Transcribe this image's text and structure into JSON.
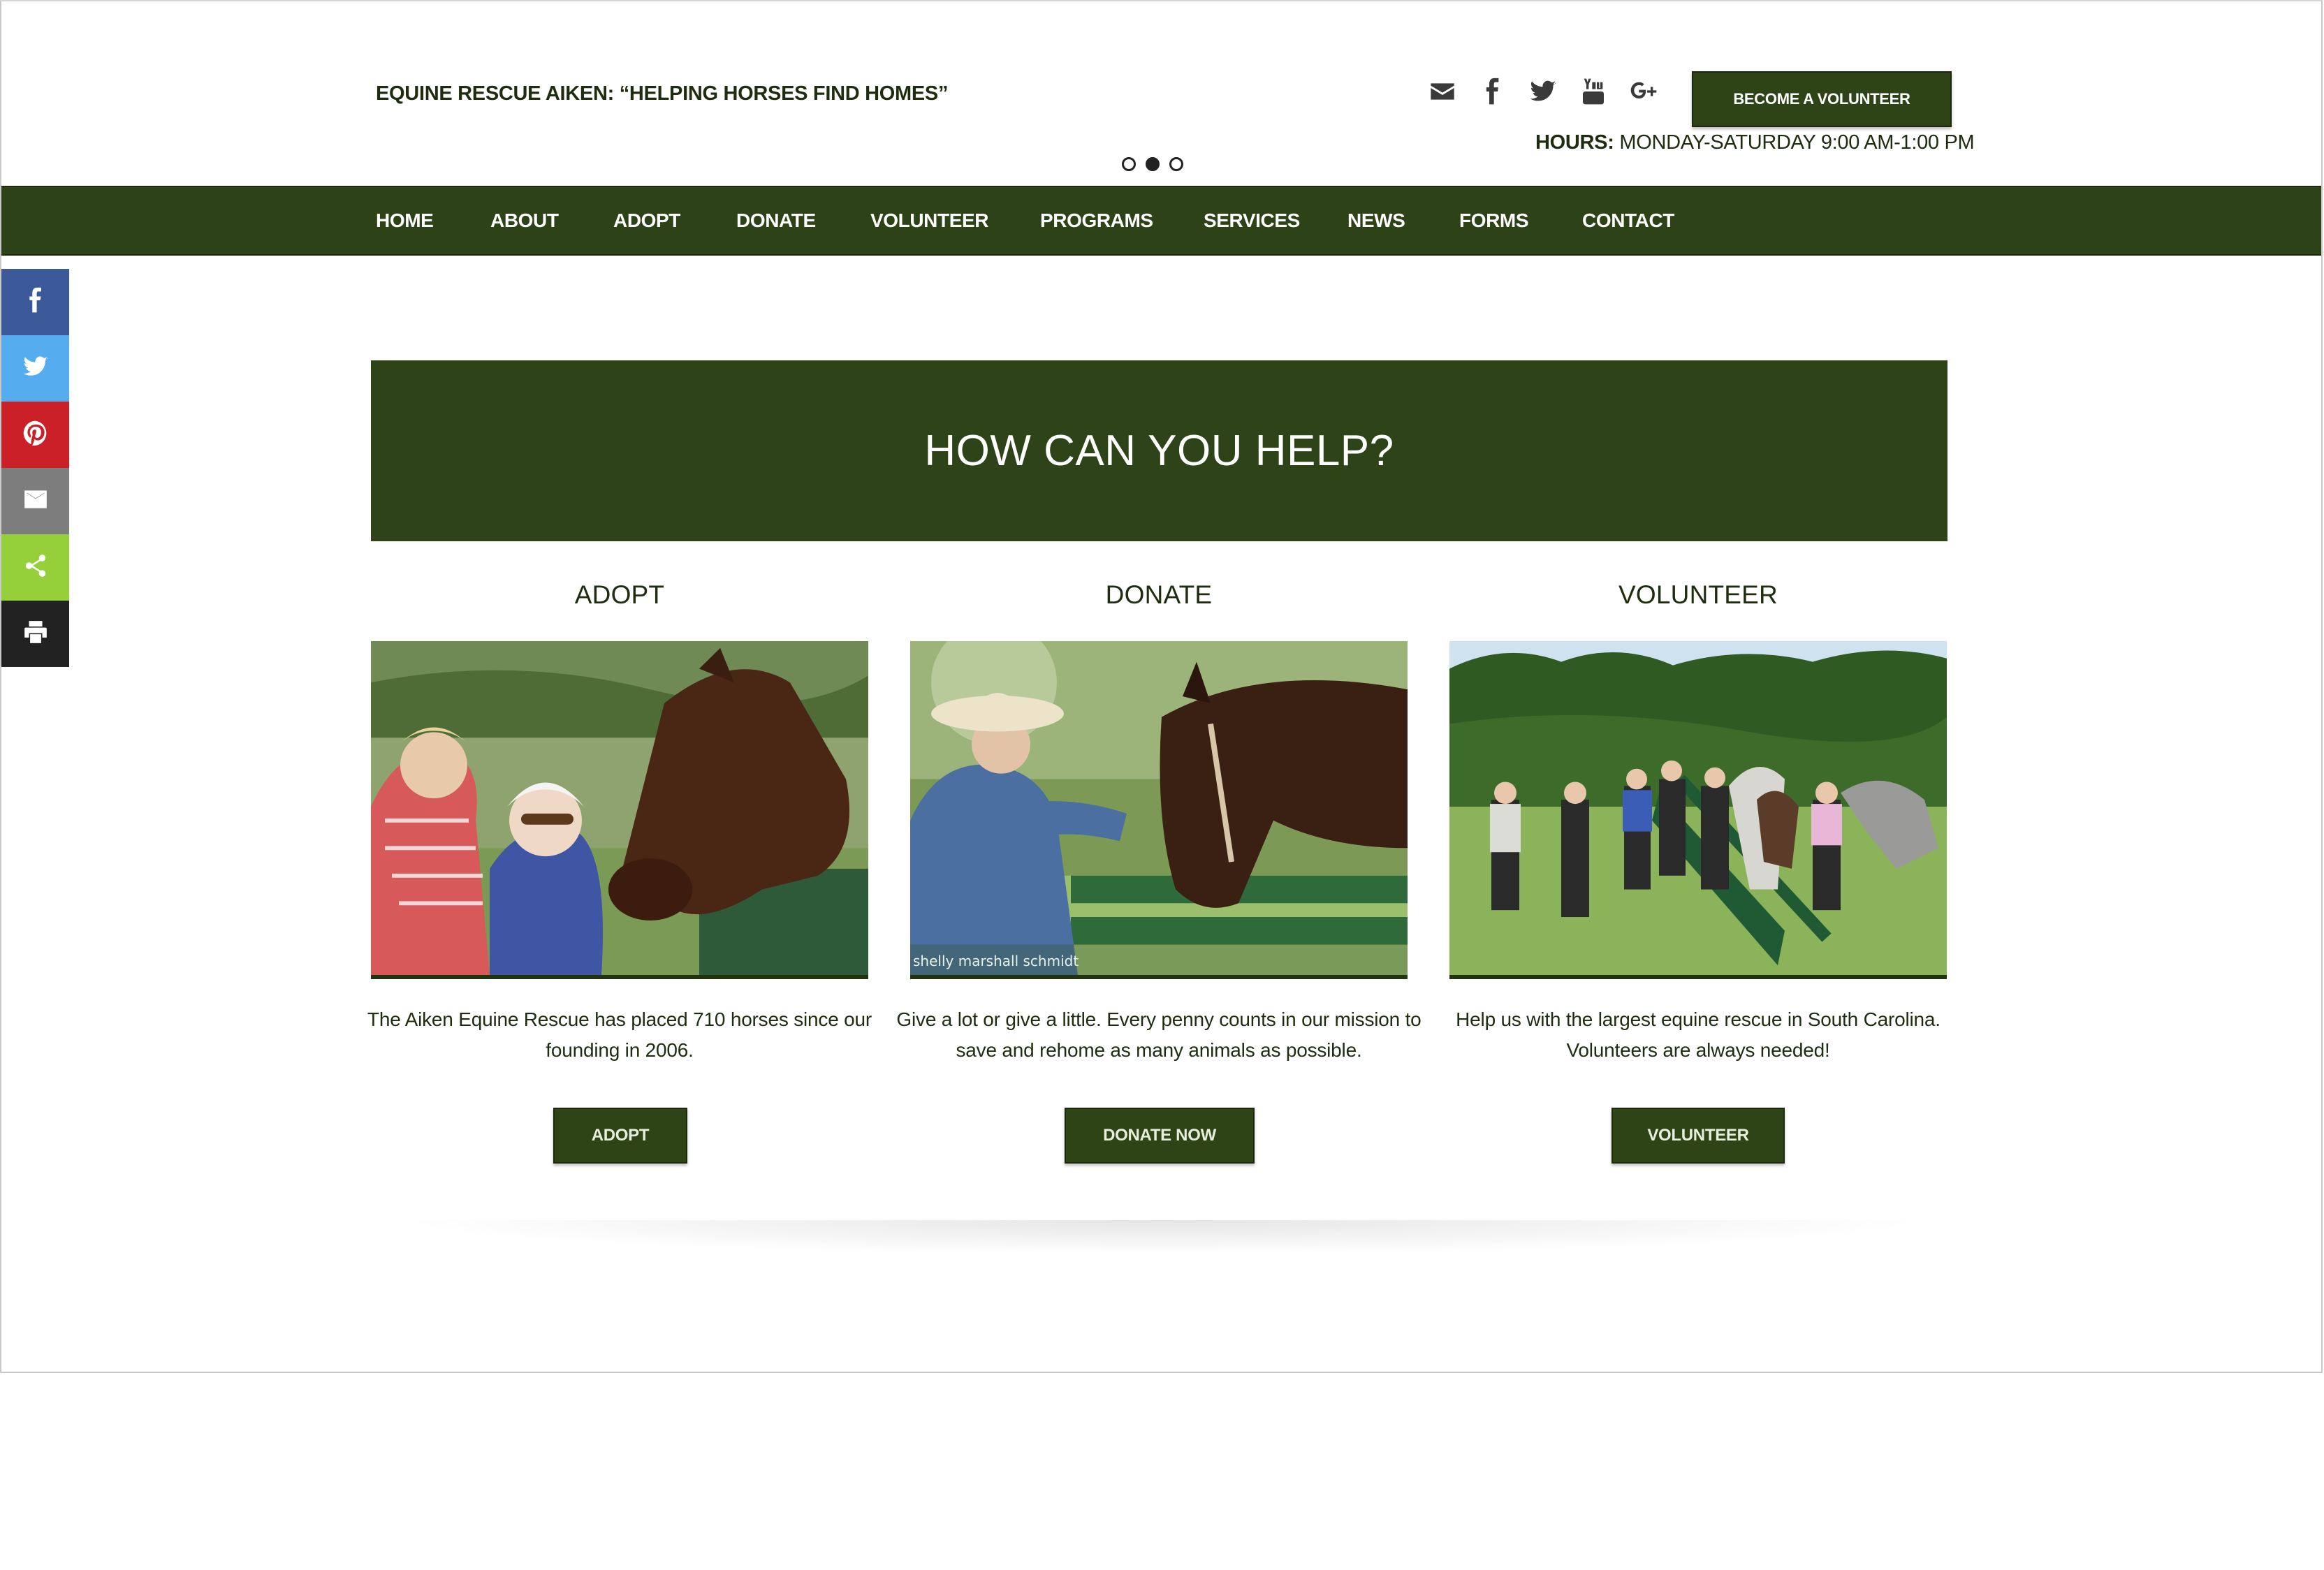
{
  "header": {
    "tagline": "EQUINE RESCUE AIKEN: “HELPING HORSES FIND HOMES”",
    "social_icons": [
      "email-icon",
      "facebook-icon",
      "twitter-icon",
      "youtube-icon",
      "google-plus-icon"
    ],
    "cta_label": "BECOME A VOLUNTEER",
    "hours_label": "HOURS:",
    "hours_value": "MONDAY-SATURDAY 9:00 AM-1:00 PM",
    "slider_dots": 3,
    "slider_active_index": 1
  },
  "nav": {
    "items": [
      "HOME",
      "ABOUT",
      "ADOPT",
      "DONATE",
      "VOLUNTEER",
      "PROGRAMS",
      "SERVICES",
      "NEWS",
      "FORMS",
      "CONTACT"
    ]
  },
  "share_bar": {
    "items": [
      {
        "icon": "facebook-icon",
        "color": "#3b5998"
      },
      {
        "icon": "twitter-icon",
        "color": "#55acee"
      },
      {
        "icon": "pinterest-icon",
        "color": "#cb2027"
      },
      {
        "icon": "email-icon",
        "color": "#7d7d7d"
      },
      {
        "icon": "share-icon",
        "color": "#95d03a"
      },
      {
        "icon": "print-icon",
        "color": "#222222"
      }
    ]
  },
  "main": {
    "banner_title": "HOW CAN YOU HELP?",
    "columns": [
      {
        "title": "ADOPT",
        "description": "The Aiken Equine Rescue has placed 710 horses since our founding in 2006.",
        "button": "ADOPT",
        "photo_credit": ""
      },
      {
        "title": "DONATE",
        "description": "Give a lot or give a little. Every penny counts in our mission to save and rehome as many animals as possible.",
        "button": "DONATE NOW",
        "photo_credit": "shelly marshall schmidt"
      },
      {
        "title": "VOLUNTEER",
        "description": "Help us with the largest equine rescue in South Carolina. Volunteers are always needed!",
        "button": "VOLUNTEER",
        "photo_credit": ""
      }
    ]
  },
  "colors": {
    "brand_green": "#2e4418",
    "text_dark": "#1e2d10"
  }
}
